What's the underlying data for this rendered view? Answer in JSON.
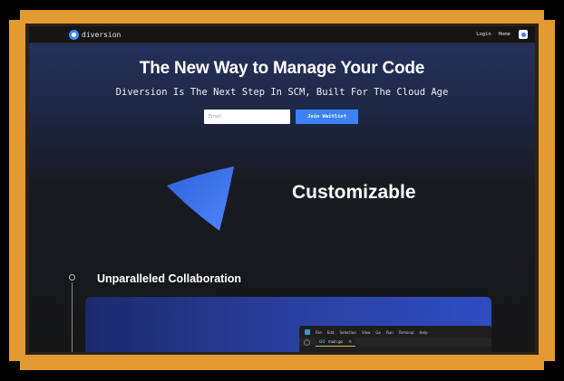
{
  "nav": {
    "logo_text": "diversion",
    "links": [
      "Login",
      "Home"
    ]
  },
  "hero": {
    "title": "The New Way to Manage Your Code",
    "subtitle": "Diversion Is The Next Step In SCM, Built For The Cloud Age",
    "email_placeholder": "Email",
    "cta_label": "Join Waitlist"
  },
  "features": {
    "customizable_heading": "Customizable",
    "collaboration_heading": "Unparalleled Collaboration"
  },
  "editor": {
    "menu": [
      "File",
      "Edit",
      "Selection",
      "View",
      "Go",
      "Run",
      "Terminal",
      "Help"
    ],
    "tab_icon": "GO",
    "tab_name": "main.go",
    "tab_close": "×"
  },
  "colors": {
    "frame": "#e39a33",
    "accent": "#3c81f6",
    "background": "#161616"
  }
}
